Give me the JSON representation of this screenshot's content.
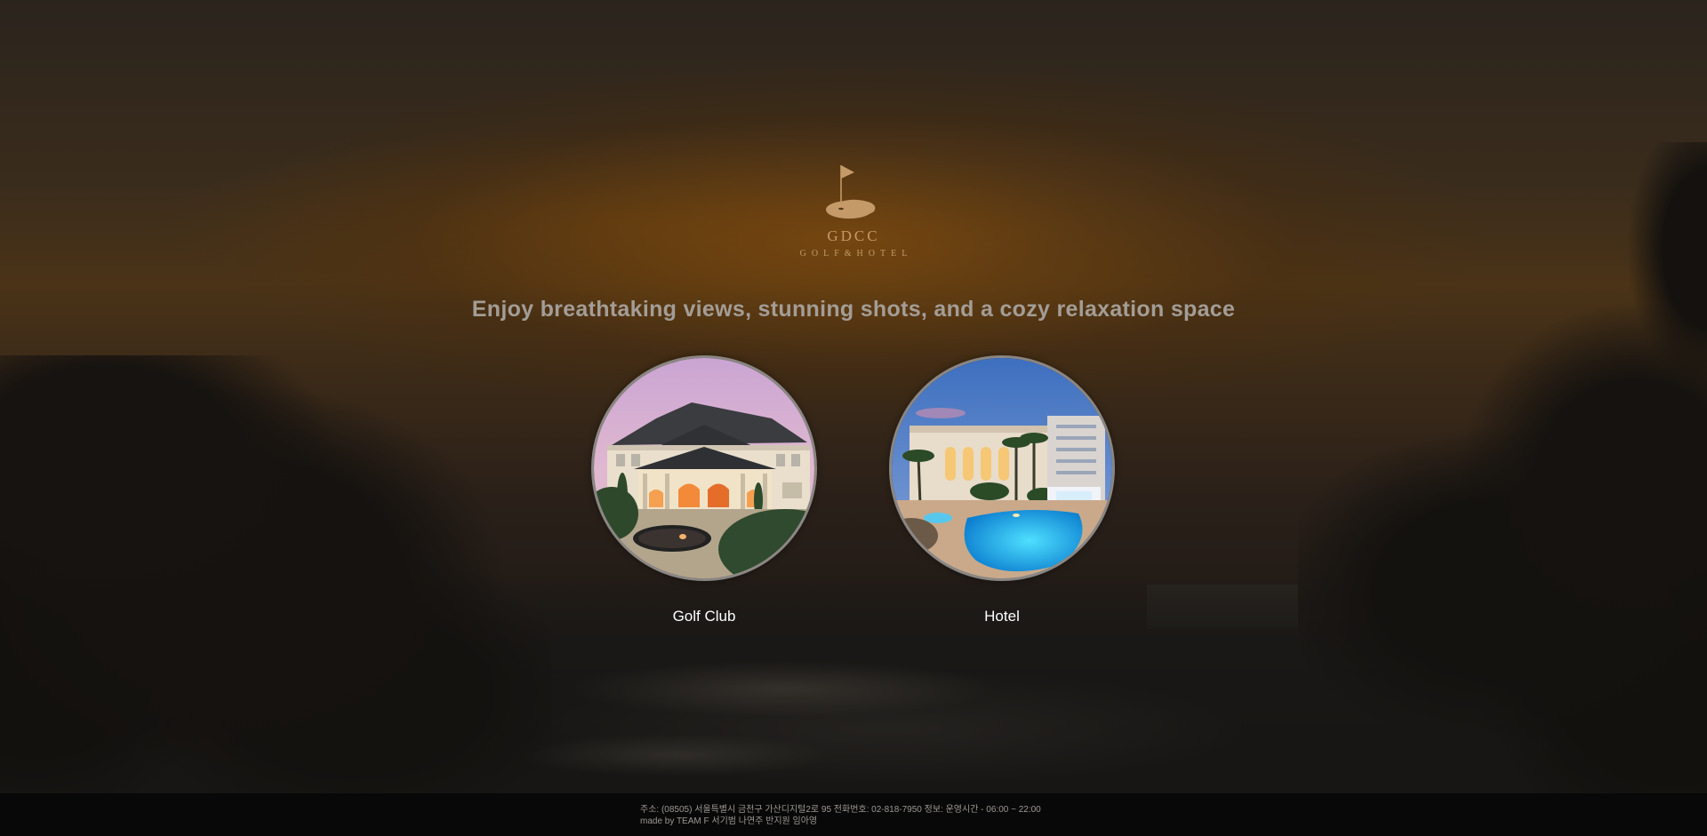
{
  "brand": {
    "name": "GDCC",
    "subtitle": "GOLF&HOTEL"
  },
  "tagline": "Enjoy breathtaking views, stunning shots, and a cozy relaxation space",
  "cards": [
    {
      "label": "Golf Club"
    },
    {
      "label": "Hotel"
    }
  ],
  "footer": {
    "address_line": "주소: (08505) 서울특별시 금천구 가산디지털2로 95 전화번호: 02-818-7950 정보: 운영시간 - 06:00 ~ 22:00",
    "credits_line": "made by TEAM F 서기범 나연주 반지원 임아영"
  },
  "colors": {
    "brand_gold": "#c59a69",
    "tagline_gray": "#a39d96",
    "footer_bg": "#0b0b0b"
  }
}
